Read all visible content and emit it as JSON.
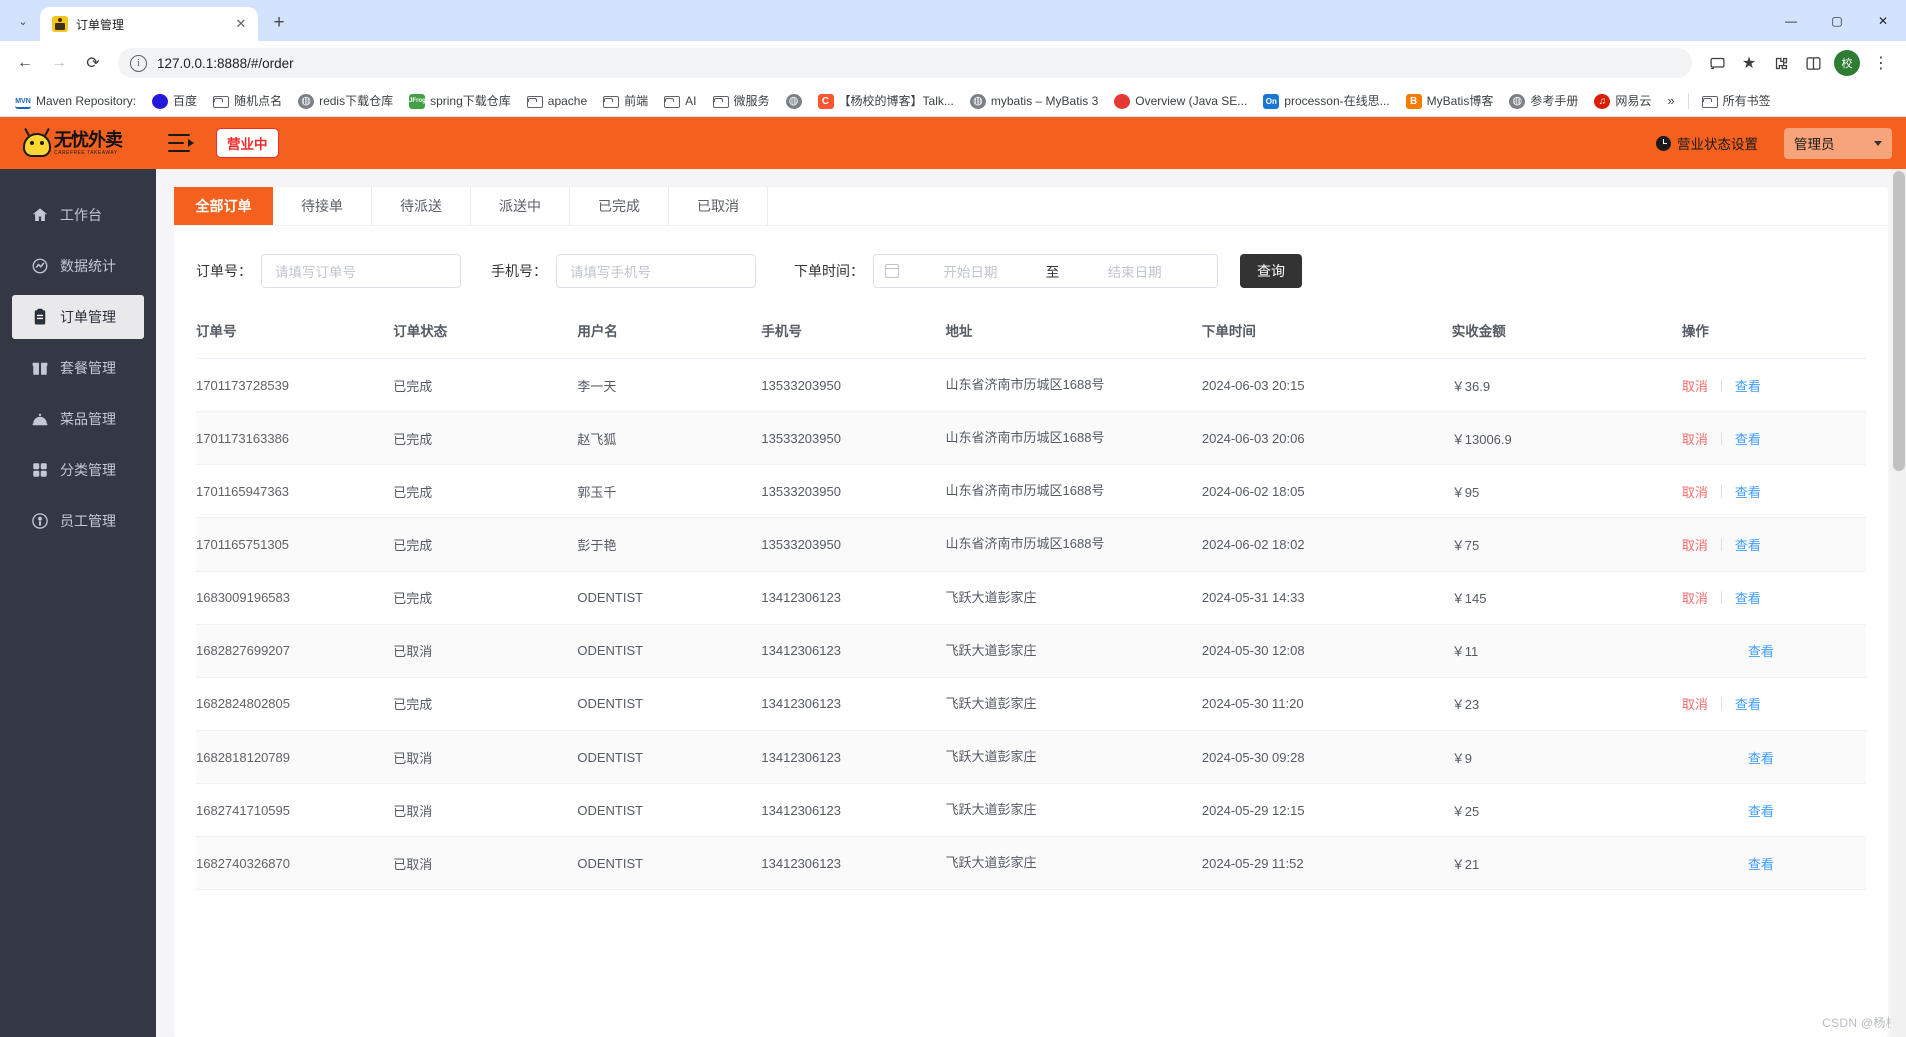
{
  "browser": {
    "tab": {
      "title": "订单管理",
      "favicon": "app-favicon",
      "close_label": "✕"
    },
    "new_tab_label": "+",
    "tabstrip_chevron": "⌄",
    "window_controls": {
      "minimize": "—",
      "maximize": "▢",
      "close": "✕"
    },
    "nav": {
      "back": "←",
      "forward": "→",
      "reload": "⟳"
    },
    "omnibox": {
      "url": "127.0.0.1:8888/#/order",
      "info_icon": "ⓘ"
    },
    "toolbar_right": {
      "cast": "cast-icon",
      "star": "★",
      "extensions": "extensions-icon",
      "split": "split-icon",
      "profile_initial": "校",
      "menu": "⋮"
    },
    "bookmarks": [
      {
        "label": "Maven Repository:",
        "icon": "mvn-icon"
      },
      {
        "label": "百度",
        "icon": "baidu-icon"
      },
      {
        "label": "随机点名",
        "icon": "folder-icon"
      },
      {
        "label": "redis下载仓库",
        "icon": "globe-icon"
      },
      {
        "label": "spring下载仓库",
        "icon": "jfrog-icon"
      },
      {
        "label": "apache",
        "icon": "folder-icon"
      },
      {
        "label": "前端",
        "icon": "folder-icon"
      },
      {
        "label": "AI",
        "icon": "folder-icon"
      },
      {
        "label": "微服务",
        "icon": "folder-icon"
      },
      {
        "label": "",
        "icon": "globe-icon"
      },
      {
        "label": "【杨校的博客】Talk...",
        "icon": "csdn-icon"
      },
      {
        "label": "mybatis – MyBatis 3",
        "icon": "globe-icon"
      },
      {
        "label": "Overview (Java SE...",
        "icon": "red-icon"
      },
      {
        "label": "processon-在线思...",
        "icon": "on-icon"
      },
      {
        "label": "MyBatis博客",
        "icon": "blogger-icon"
      },
      {
        "label": "参考手册",
        "icon": "globe-icon"
      },
      {
        "label": "网易云",
        "icon": "netease-icon"
      },
      {
        "label": "所有书签",
        "icon": "folder-icon"
      }
    ],
    "bookmarks_overflow": "»"
  },
  "app": {
    "header": {
      "logo_cn": "无忧外卖",
      "logo_en": "CAREFREE TAKEAWAY",
      "status_pill": "营业中",
      "business_status_label": "营业状态设置",
      "user_role": "管理员"
    },
    "sidebar": {
      "items": [
        {
          "label": "工作台",
          "icon": "home-icon",
          "active": false
        },
        {
          "label": "数据统计",
          "icon": "chart-circle-icon",
          "active": false
        },
        {
          "label": "订单管理",
          "icon": "clipboard-icon",
          "active": true
        },
        {
          "label": "套餐管理",
          "icon": "gift-icon",
          "active": false
        },
        {
          "label": "菜品管理",
          "icon": "dish-cover-icon",
          "active": false
        },
        {
          "label": "分类管理",
          "icon": "grid-icon",
          "active": false
        },
        {
          "label": "员工管理",
          "icon": "user-circle-icon",
          "active": false
        }
      ]
    },
    "tabs": [
      {
        "label": "全部订单",
        "active": true
      },
      {
        "label": "待接单",
        "active": false
      },
      {
        "label": "待派送",
        "active": false
      },
      {
        "label": "派送中",
        "active": false
      },
      {
        "label": "已完成",
        "active": false
      },
      {
        "label": "已取消",
        "active": false
      }
    ],
    "filters": {
      "order_label": "订单号：",
      "order_placeholder": "请填写订单号",
      "order_value": "",
      "phone_label": "手机号：",
      "phone_placeholder": "请填写手机号",
      "phone_value": "",
      "date_label": "下单时间：",
      "date_start_placeholder": "开始日期",
      "date_end_placeholder": "结束日期",
      "date_separator": "至",
      "search_button": "查询"
    },
    "table": {
      "columns": [
        "订单号",
        "订单状态",
        "用户名",
        "手机号",
        "地址",
        "下单时间",
        "实收金额",
        "操作"
      ],
      "op_cancel": "取消",
      "op_view": "查看",
      "rows": [
        {
          "order_no": "1701173728539",
          "status": "已完成",
          "user": "李一天",
          "phone": "13533203950",
          "address": "山东省济南市历城区1688号",
          "time": "2024-06-03 20:15",
          "amount": "￥36.9",
          "can_cancel": true
        },
        {
          "order_no": "1701173163386",
          "status": "已完成",
          "user": "赵飞狐",
          "phone": "13533203950",
          "address": "山东省济南市历城区1688号",
          "time": "2024-06-03 20:06",
          "amount": "￥13006.9",
          "can_cancel": true
        },
        {
          "order_no": "1701165947363",
          "status": "已完成",
          "user": "郭玉千",
          "phone": "13533203950",
          "address": "山东省济南市历城区1688号",
          "time": "2024-06-02 18:05",
          "amount": "￥95",
          "can_cancel": true
        },
        {
          "order_no": "1701165751305",
          "status": "已完成",
          "user": "彭于艳",
          "phone": "13533203950",
          "address": "山东省济南市历城区1688号",
          "time": "2024-06-02 18:02",
          "amount": "￥75",
          "can_cancel": true
        },
        {
          "order_no": "1683009196583",
          "status": "已完成",
          "user": "ODENTIST",
          "phone": "13412306123",
          "address": "飞跃大道彭家庄",
          "time": "2024-05-31 14:33",
          "amount": "￥145",
          "can_cancel": true
        },
        {
          "order_no": "1682827699207",
          "status": "已取消",
          "user": "ODENTIST",
          "phone": "13412306123",
          "address": "飞跃大道彭家庄",
          "time": "2024-05-30 12:08",
          "amount": "￥11",
          "can_cancel": false
        },
        {
          "order_no": "1682824802805",
          "status": "已完成",
          "user": "ODENTIST",
          "phone": "13412306123",
          "address": "飞跃大道彭家庄",
          "time": "2024-05-30 11:20",
          "amount": "￥23",
          "can_cancel": true
        },
        {
          "order_no": "1682818120789",
          "status": "已取消",
          "user": "ODENTIST",
          "phone": "13412306123",
          "address": "飞跃大道彭家庄",
          "time": "2024-05-30 09:28",
          "amount": "￥9",
          "can_cancel": false
        },
        {
          "order_no": "1682741710595",
          "status": "已取消",
          "user": "ODENTIST",
          "phone": "13412306123",
          "address": "飞跃大道彭家庄",
          "time": "2024-05-29 12:15",
          "amount": "￥25",
          "can_cancel": false
        },
        {
          "order_no": "1682740326870",
          "status": "已取消",
          "user": "ODENTIST",
          "phone": "13412306123",
          "address": "飞跃大道彭家庄",
          "time": "2024-05-29 11:52",
          "amount": "￥21",
          "can_cancel": false
        }
      ]
    },
    "watermark": "CSDN @杨校"
  },
  "colors": {
    "brand_orange": "#f4601d",
    "sidebar_bg": "#343744",
    "status_red": "#f02b2b",
    "link_blue": "#409eff",
    "danger_red": "#f56c6c"
  }
}
